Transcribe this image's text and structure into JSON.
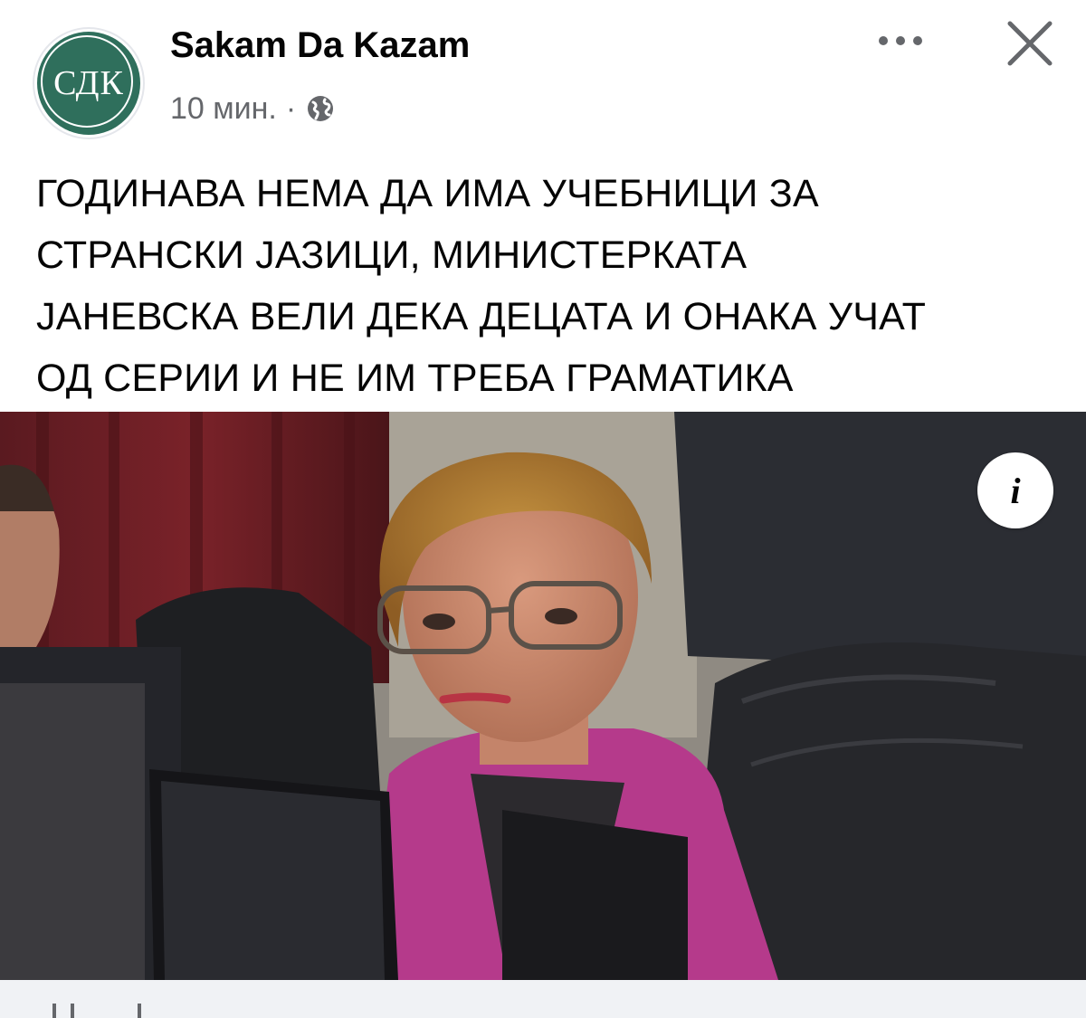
{
  "post": {
    "page_name": "Sakam Da Kazam",
    "avatar_text": "СДК",
    "time": "10 мин.",
    "separator": "·",
    "audience_icon": "globe-icon",
    "text_lines": [
      "ГОДИНАВА НЕМА ДА ИМА УЧЕБНИЦИ ЗА",
      "СТРАНСКИ ЈАЗИЦИ, МИНИСТЕРКАТА",
      "ЈАНЕВСКА ВЕЛИ ДЕКА ДЕЦАТА И ОНАКА УЧАТ",
      "ОД СЕРИИ И НЕ ИМ ТРЕБА ГРАМАТИКА"
    ],
    "info_label": "i"
  },
  "icons": {
    "more": "more-dots-icon",
    "close": "close-icon",
    "globe": "globe-icon",
    "info": "info-icon"
  },
  "colors": {
    "avatar_bg": "#2f6f5c",
    "meta_text": "#65676b",
    "text": "#050505"
  }
}
